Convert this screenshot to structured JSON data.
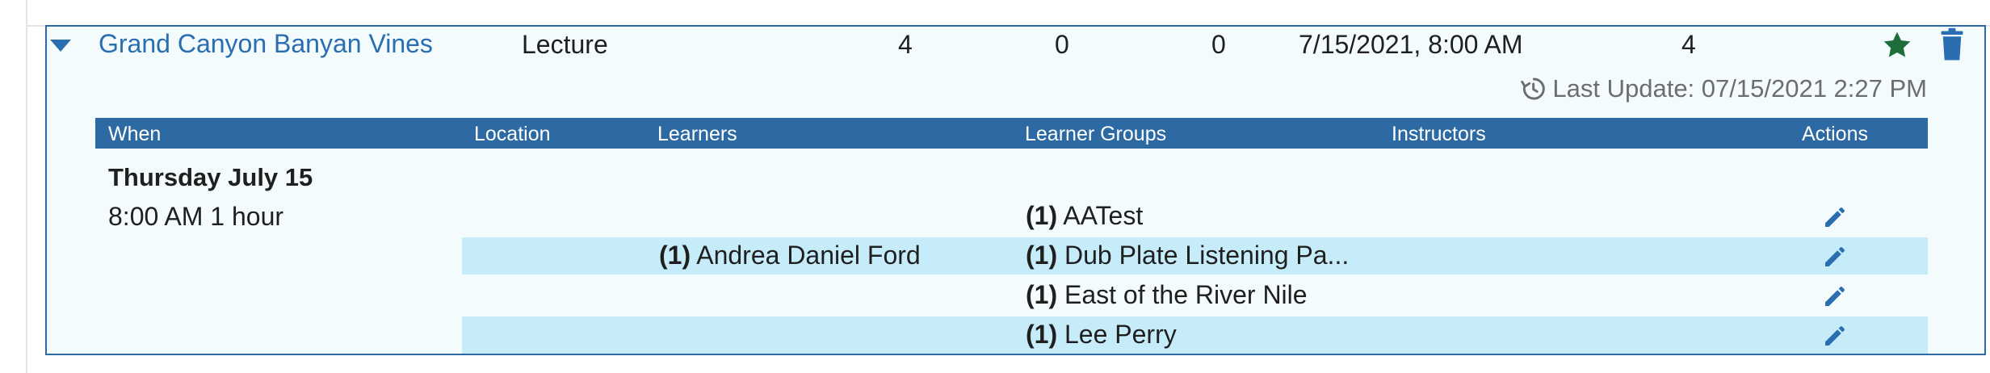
{
  "session": {
    "title": "Grand Canyon Banyan Vines",
    "type": "Lecture",
    "count_a": "4",
    "count_b": "0",
    "count_c": "0",
    "datetime": "7/15/2021, 8:00 AM",
    "offerings": "4",
    "last_update": "Last Update: 07/15/2021 2:27 PM"
  },
  "table": {
    "headers": {
      "when": "When",
      "location": "Location",
      "learners": "Learners",
      "learner_groups": "Learner Groups",
      "instructors": "Instructors",
      "actions": "Actions"
    },
    "day": "Thursday July 15",
    "time": "8:00 AM 1 hour",
    "rows": [
      {
        "learners_count": "",
        "learners_name": "",
        "group_count": "(1)",
        "group_name": "AATest"
      },
      {
        "learners_count": "(1)",
        "learners_name": "Andrea Daniel Ford",
        "group_count": "(1)",
        "group_name": "Dub Plate Listening Pa..."
      },
      {
        "learners_count": "",
        "learners_name": "",
        "group_count": "(1)",
        "group_name": "East of the River Nile"
      },
      {
        "learners_count": "",
        "learners_name": "",
        "group_count": "(1)",
        "group_name": "Lee Perry"
      }
    ]
  },
  "colors": {
    "accent": "#2d6aa3",
    "link": "#2a6db0",
    "star": "#1e6e3c",
    "row_alt": "#c6ecfa",
    "panel_bg": "#f3fbfd"
  },
  "icons": {
    "collapse": "chevron-down-icon",
    "star": "star-icon",
    "delete": "trash-icon",
    "history": "history-icon",
    "edit": "pencil-icon"
  }
}
